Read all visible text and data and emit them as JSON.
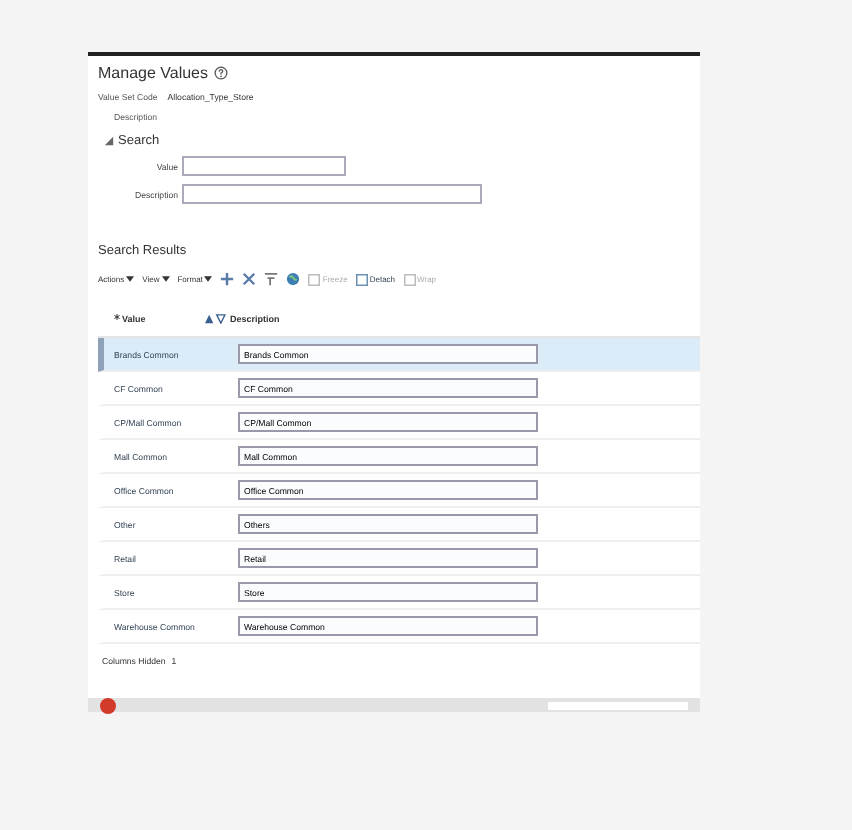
{
  "page": {
    "title": "Manage Values",
    "value_set_code_label": "Value Set Code",
    "value_set_code": "Allocation_Type_Store",
    "description_label": "Description"
  },
  "search": {
    "title": "Search",
    "expanded": true,
    "fields": [
      {
        "label": "Value",
        "wide": false
      },
      {
        "label": "Description",
        "wide": true
      }
    ]
  },
  "results": {
    "title": "Search Results",
    "menus": [
      "Actions",
      "View",
      "Format"
    ],
    "toolbar_buttons": [
      {
        "label": "Freeze",
        "disabled": true
      },
      {
        "label": "Detach",
        "disabled": false
      },
      {
        "label": "Wrap",
        "disabled": true
      }
    ],
    "columns": [
      {
        "label": "Value",
        "required": true
      },
      {
        "label": "Description"
      }
    ],
    "rows": [
      {
        "value": "Brands Common",
        "description": "Brands Common",
        "selected": true
      },
      {
        "value": "CF Common",
        "description": "CF Common",
        "selected": false
      },
      {
        "value": "CP/Mall Common",
        "description": "CP/Mall Common",
        "selected": false
      },
      {
        "value": "Mall Common",
        "description": "Mall Common",
        "selected": false
      },
      {
        "value": "Office Common",
        "description": "Office Common",
        "selected": false
      },
      {
        "value": "Other",
        "description": "Others",
        "selected": false
      },
      {
        "value": "Retail",
        "description": "Retail",
        "selected": false
      },
      {
        "value": "Store",
        "description": "Store",
        "selected": false
      },
      {
        "value": "Warehouse Common",
        "description": "Warehouse Common",
        "selected": false
      }
    ],
    "columns_hidden_label": "Columns Hidden",
    "columns_hidden": "1"
  }
}
